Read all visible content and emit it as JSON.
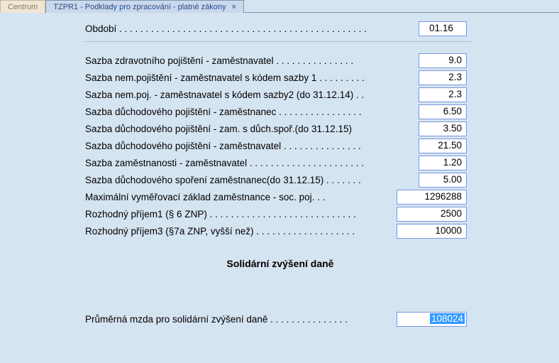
{
  "tabs": {
    "inactive": "Centrum",
    "active": "TZPR1 - Podklady pro zpracování - platné zákony",
    "close_glyph": "×"
  },
  "rows": {
    "obdobi": {
      "label": "Období . . . . . . . . . . . . . . . . . . . . . . . . . . . . . . . . . . . . . . . . . . . . . . .",
      "value": "01.16"
    },
    "zdrav_zamv": {
      "label": "Sazba zdravotního pojištění - zaměstnavatel . . . . . . . . . . . . . . .",
      "value": "9.0"
    },
    "nem_zamv_k1": {
      "label": "Sazba nem.pojištění - zaměstnavatel s kódem sazby 1 . . . . . . . . .",
      "value": "2.3"
    },
    "nem_zamv_k2": {
      "label": "Sazba nem.poj. - zaměstnavatel s kódem sazby2 (do 31.12.14) . .",
      "value": "2.3"
    },
    "duch_zamc": {
      "label": "Sazba důchodového pojištění - zaměstnanec . . . . . . . . . . . . . . . .",
      "value": "6.50"
    },
    "duch_zamc_spor": {
      "label": "Sazba důchodového pojištění - zam. s důch.spoř.(do 31.12.15)",
      "value": "3.50"
    },
    "duch_zamv": {
      "label": "Sazba důchodového pojištění - zaměstnavatel . . . . . . . . . . . . . . .",
      "value": "21.50"
    },
    "nezam_zamv": {
      "label": "Sazba zaměstnanosti - zaměstnavatel . . . . . . . . . . . . . . . . . . . . . .",
      "value": "1.20"
    },
    "duch_spor_zamc": {
      "label": "Sazba důchodového spoření zaměstnanec(do 31.12.15) . . . . . . .",
      "value": "5.00"
    },
    "max_vymz": {
      "label": "Maximální vyměřovací základ zaměstnance - soc. poj. . .",
      "value": "1296288"
    },
    "rozh_prijem1": {
      "label": "Rozhodný příjem1 (§ 6 ZNP) . . . . . . . . . . . . . . . . . . . . . . . . . . . .",
      "value": "2500"
    },
    "rozh_prijem3": {
      "label": "Rozhodný příjem3 (§7a ZNP, vyšší než) . . . . . . . . . . . . . . . . . . .",
      "value": "10000"
    },
    "prum_mzda_solid": {
      "label": "Průměrná mzda pro solidární zvýšení daně . . . . . . . . . . . . . . .",
      "value": "108024"
    }
  },
  "section_title": "Solidární zvýšení daně"
}
